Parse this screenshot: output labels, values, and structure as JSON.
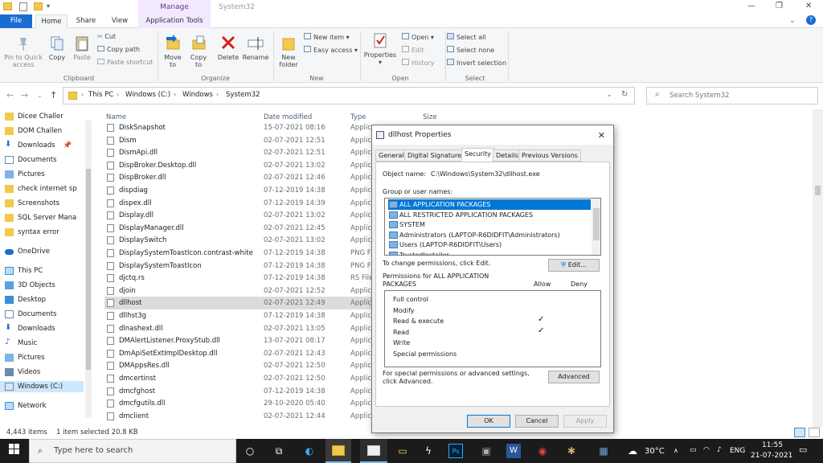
{
  "window": {
    "title": "System32",
    "context_tab": "Manage",
    "controls": [
      "—",
      "❐",
      "✕"
    ]
  },
  "tabs": [
    "File",
    "Home",
    "Share",
    "View",
    "Application Tools"
  ],
  "ribbon": {
    "clipboard": {
      "pin": "Pin to Quick access",
      "copy": "Copy",
      "paste": "Paste",
      "cut": "Cut",
      "copy_path": "Copy path",
      "paste_shortcut": "Paste shortcut",
      "group": "Clipboard"
    },
    "organize": {
      "move_to": "Move to",
      "copy_to": "Copy to",
      "delete": "Delete",
      "rename": "Rename",
      "group": "Organize"
    },
    "new": {
      "new_folder": "New folder",
      "new_item": "New item",
      "easy_access": "Easy access",
      "group": "New"
    },
    "open": {
      "properties": "Properties",
      "open": "Open",
      "edit": "Edit",
      "history": "History",
      "group": "Open"
    },
    "select": {
      "select_all": "Select all",
      "select_none": "Select none",
      "invert": "Invert selection",
      "group": "Select"
    }
  },
  "address": {
    "path": [
      "This PC",
      "Windows (C:)",
      "Windows",
      "System32"
    ],
    "search_placeholder": "Search System32"
  },
  "nav": {
    "quick": [
      "Dicee Challer",
      "DOM Challen",
      "Downloads",
      "Documents",
      "Pictures",
      "check internet sp",
      "Screenshots",
      "SQL Server Mana",
      "syntax error"
    ],
    "onedrive": "OneDrive",
    "thispc": "This PC",
    "pc_items": [
      "3D Objects",
      "Desktop",
      "Documents",
      "Downloads",
      "Music",
      "Pictures",
      "Videos",
      "Windows (C:)"
    ],
    "network": "Network"
  },
  "columns": {
    "name": "Name",
    "date": "Date modified",
    "type": "Type",
    "size": "Size"
  },
  "files": [
    {
      "name": "DiskSnapshot",
      "date": "15-07-2021 08:16",
      "type": "Applic"
    },
    {
      "name": "Dism",
      "date": "02-07-2021 12:51",
      "type": "Applic"
    },
    {
      "name": "DismApi.dll",
      "date": "02-07-2021 12:51",
      "type": "Applic"
    },
    {
      "name": "DispBroker.Desktop.dll",
      "date": "02-07-2021 13:02",
      "type": "Applic"
    },
    {
      "name": "DispBroker.dll",
      "date": "02-07-2021 12:46",
      "type": "Applic"
    },
    {
      "name": "dispdiag",
      "date": "07-12-2019 14:38",
      "type": "Applic"
    },
    {
      "name": "dispex.dll",
      "date": "07-12-2019 14:39",
      "type": "Applic"
    },
    {
      "name": "Display.dll",
      "date": "02-07-2021 13:02",
      "type": "Applic"
    },
    {
      "name": "DisplayManager.dll",
      "date": "02-07-2021 12:45",
      "type": "Applic"
    },
    {
      "name": "DisplaySwitch",
      "date": "02-07-2021 13:02",
      "type": "Applic"
    },
    {
      "name": "DisplaySystemToastIcon.contrast-white",
      "date": "07-12-2019 14:38",
      "type": "PNG F"
    },
    {
      "name": "DisplaySystemToastIcon",
      "date": "07-12-2019 14:38",
      "type": "PNG F"
    },
    {
      "name": "djctq.rs",
      "date": "07-12-2019 14:38",
      "type": "RS File"
    },
    {
      "name": "djoin",
      "date": "02-07-2021 12:52",
      "type": "Applic"
    },
    {
      "name": "dllhost",
      "date": "02-07-2021 12:49",
      "type": "Applic"
    },
    {
      "name": "dllhst3g",
      "date": "07-12-2019 14:38",
      "type": "Applic"
    },
    {
      "name": "dlnashext.dll",
      "date": "02-07-2021 13:05",
      "type": "Applic"
    },
    {
      "name": "DMAlertListener.ProxyStub.dll",
      "date": "13-07-2021 08:17",
      "type": "Applic"
    },
    {
      "name": "DmApiSetExtImplDesktop.dll",
      "date": "02-07-2021 12:43",
      "type": "Applic"
    },
    {
      "name": "DMAppsRes.dll",
      "date": "02-07-2021 12:50",
      "type": "Applic"
    },
    {
      "name": "dmcertinst",
      "date": "02-07-2021 12:50",
      "type": "Applic"
    },
    {
      "name": "dmcfghost",
      "date": "07-12-2019 14:38",
      "type": "Applic"
    },
    {
      "name": "dmcfgutils.dll",
      "date": "29-10-2020 05:40",
      "type": "Applic"
    },
    {
      "name": "dmclient",
      "date": "02-07-2021 12:44",
      "type": "Applic"
    }
  ],
  "status": {
    "items": "4,443 items",
    "selected": "1 item selected  20.8 KB"
  },
  "dialog": {
    "title": "dllhost Properties",
    "tabs": [
      "General",
      "Digital Signatures",
      "Security",
      "Details",
      "Previous Versions"
    ],
    "object_label": "Object name:",
    "object_value": "C:\\Windows\\System32\\dllhost.exe",
    "groups_label": "Group or user names:",
    "groups": [
      "ALL APPLICATION PACKAGES",
      "ALL RESTRICTED APPLICATION PACKAGES",
      "SYSTEM",
      "Administrators (LAPTOP-R6DIDFIT\\Administrators)",
      "Users (LAPTOP-R6DIDFIT\\Users)",
      "TrustedInstaller"
    ],
    "change_text": "To change permissions, click Edit.",
    "edit_btn": "Edit...",
    "perm_for": "Permissions for ALL APPLICATION PACKAGES",
    "allow": "Allow",
    "deny": "Deny",
    "permissions": [
      {
        "name": "Full control",
        "allow": ""
      },
      {
        "name": "Modify",
        "allow": ""
      },
      {
        "name": "Read & execute",
        "allow": "✓"
      },
      {
        "name": "Read",
        "allow": "✓"
      },
      {
        "name": "Write",
        "allow": ""
      },
      {
        "name": "Special permissions",
        "allow": ""
      }
    ],
    "special_text": "For special permissions or advanced settings, click Advanced.",
    "advanced_btn": "Advanced",
    "ok": "OK",
    "cancel": "Cancel",
    "apply": "Apply"
  },
  "taskbar": {
    "search": "Type here to search",
    "weather": "30°C",
    "lang": "ENG",
    "time": "11:55",
    "date": "21-07-2021"
  }
}
